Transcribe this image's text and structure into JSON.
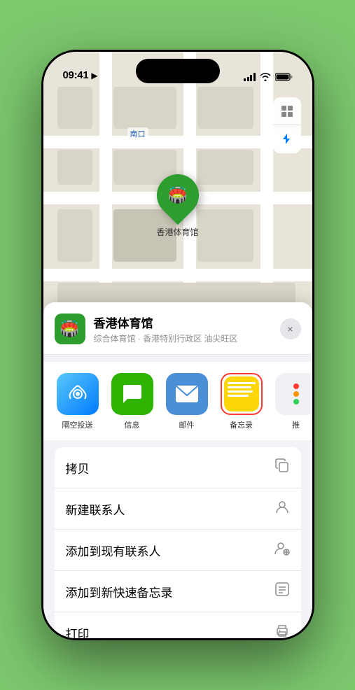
{
  "status_bar": {
    "time": "09:41",
    "location_arrow": "▶"
  },
  "map": {
    "label": "南口",
    "venue_name_map": "香港体育馆"
  },
  "venue": {
    "title": "香港体育馆",
    "subtitle": "综合体育馆 · 香港特别行政区 油尖旺区",
    "icon": "🏟️"
  },
  "share_items": [
    {
      "id": "airdrop",
      "label": "隔空投送",
      "type": "airdrop"
    },
    {
      "id": "message",
      "label": "信息",
      "type": "message"
    },
    {
      "id": "mail",
      "label": "邮件",
      "type": "mail"
    },
    {
      "id": "notes",
      "label": "备忘录",
      "type": "notes"
    },
    {
      "id": "more",
      "label": "推",
      "type": "more"
    }
  ],
  "actions": [
    {
      "id": "copy",
      "label": "拷贝",
      "icon": "copy"
    },
    {
      "id": "new-contact",
      "label": "新建联系人",
      "icon": "person"
    },
    {
      "id": "add-existing",
      "label": "添加到现有联系人",
      "icon": "person-add"
    },
    {
      "id": "add-notes",
      "label": "添加到新快速备忘录",
      "icon": "notes"
    },
    {
      "id": "print",
      "label": "打印",
      "icon": "print"
    }
  ],
  "close_label": "×"
}
